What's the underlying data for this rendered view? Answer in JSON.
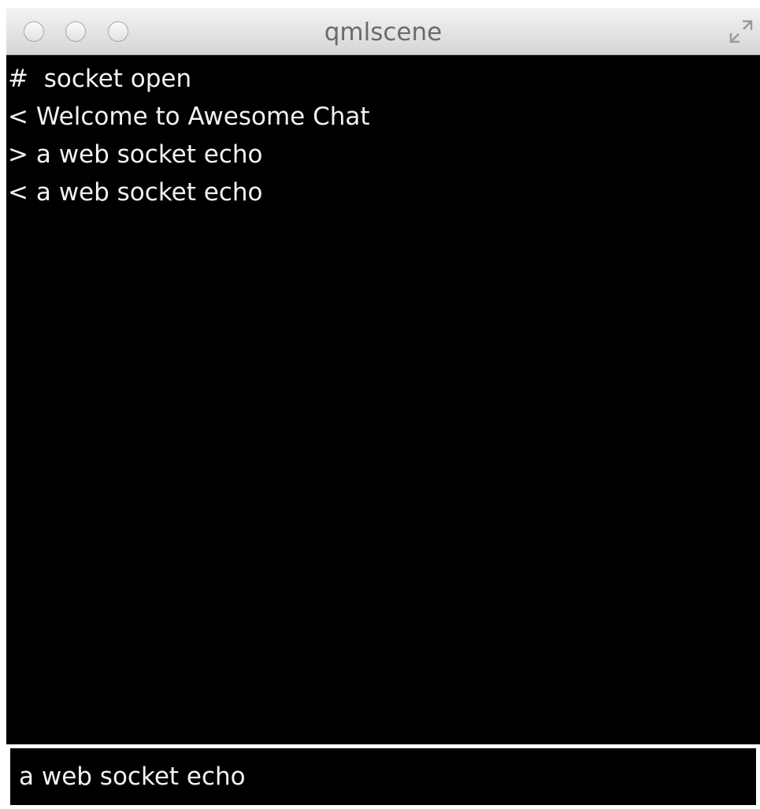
{
  "window": {
    "title": "qmlscene"
  },
  "messages": [
    {
      "prefix": "#",
      "text": "socket open"
    },
    {
      "prefix": "<",
      "text": "Welcome to Awesome Chat"
    },
    {
      "prefix": ">",
      "text": "a web socket echo"
    },
    {
      "prefix": "<",
      "text": "a web socket echo"
    }
  ],
  "input": {
    "value": "a web socket echo"
  },
  "icons": {
    "close": "close-icon",
    "minimize": "minimize-icon",
    "zoom": "zoom-icon",
    "fullscreen": "fullscreen-icon"
  },
  "colors": {
    "background": "#000000",
    "text": "#f2f2f2",
    "titlebar": "#e3e3e3",
    "title_text": "#6b6b6b"
  }
}
